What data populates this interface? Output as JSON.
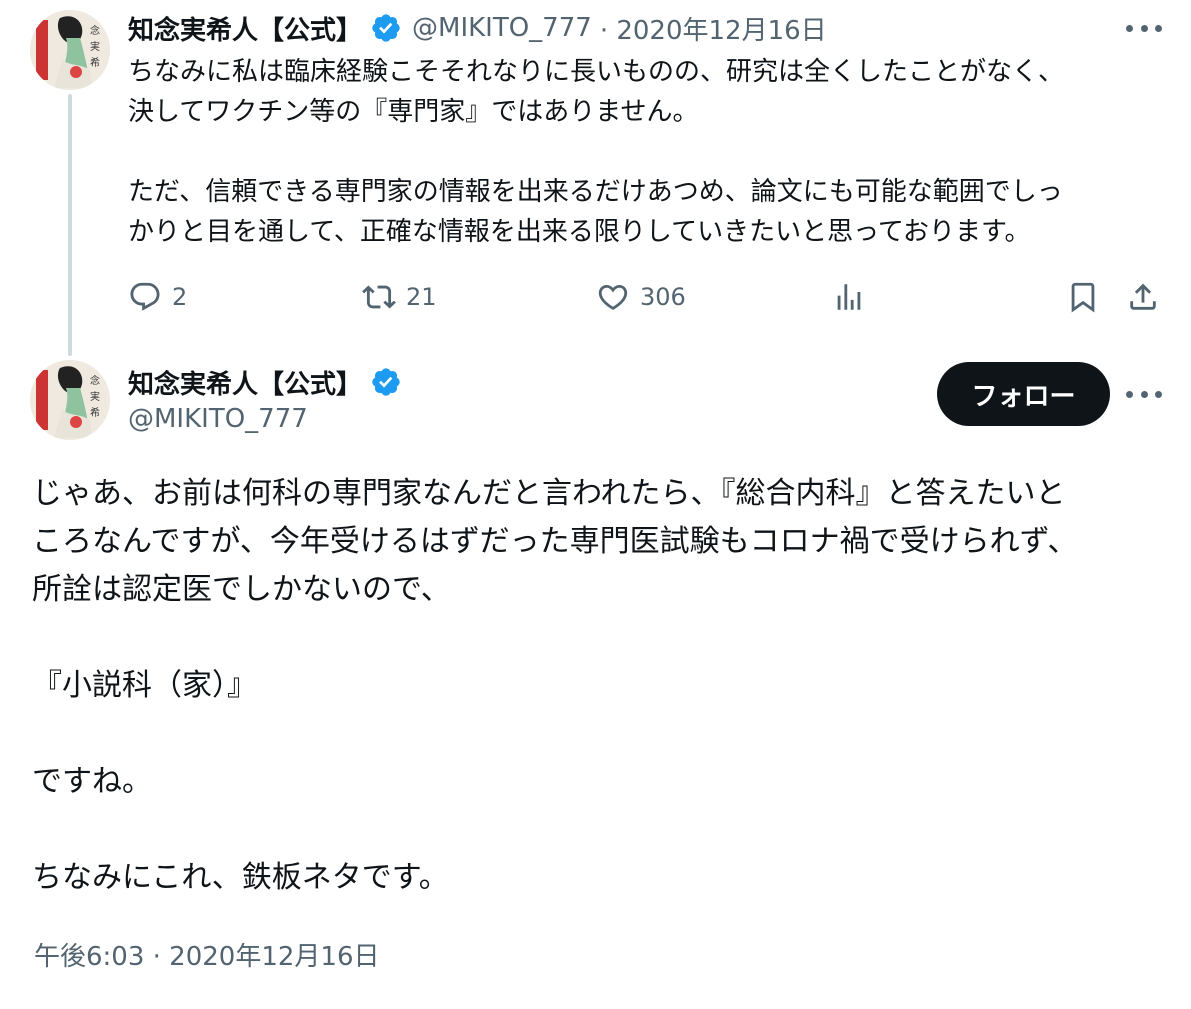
{
  "colors": {
    "accent": "#1d9bf0",
    "text": "#0f1419",
    "muted": "#536471",
    "follow_bg": "#0f1419"
  },
  "avatar_text": {
    "chars1": "念 実 希",
    "chars2": "天久鷹央の推理カルテ"
  },
  "parent_tweet": {
    "author_name": "知念実希人【公式】",
    "handle": "@MIKITO_777",
    "date": "· 2020年12月16日",
    "lines": [
      "ちなみに私は臨床経験こそそれなりに長いものの、研究は全くしたことがなく、",
      "決してワクチン等の『専門家』ではありません。",
      "",
      "ただ、信頼できる専門家の情報を出来るだけあつめ、論文にも可能な範囲でしっ",
      "かりと目を通して、正確な情報を出来る限りしていきたいと思っております。"
    ],
    "actions": {
      "replies": "2",
      "retweets": "21",
      "likes": "306"
    }
  },
  "main_tweet": {
    "author_name": "知念実希人【公式】",
    "handle": "@MIKITO_777",
    "follow_label": "フォロー",
    "lines": [
      "じゃあ、お前は何科の専門家なんだと言われたら、『総合内科』と答えたいと",
      "ころなんですが、今年受けるはずだった専門医試験もコロナ禍で受けられず、",
      "所詮は認定医でしかないので、",
      "",
      "『小説科（家）』",
      "",
      "ですね。",
      "",
      "ちなみにこれ、鉄板ネタです。"
    ],
    "timestamp": "午後6:03 · 2020年12月16日"
  },
  "icons": [
    "reply-icon",
    "retweet-icon",
    "like-icon",
    "views-icon",
    "bookmark-icon",
    "share-icon",
    "more-icon",
    "verified-badge-icon"
  ]
}
